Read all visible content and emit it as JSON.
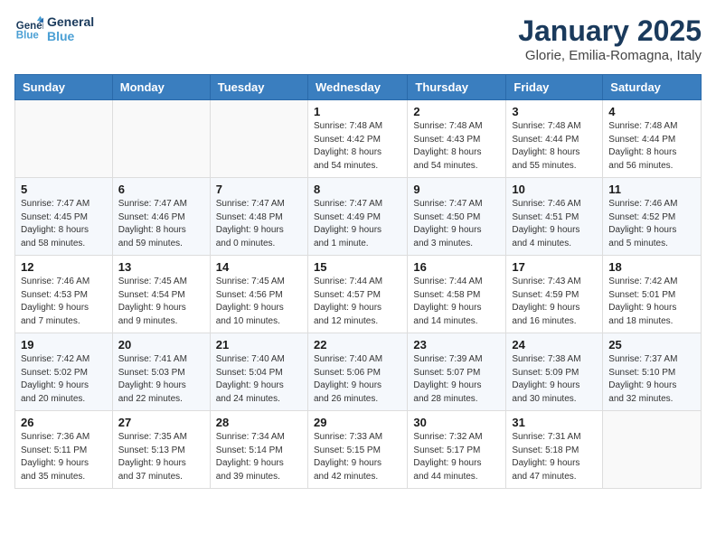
{
  "logo": {
    "line1": "General",
    "line2": "Blue"
  },
  "title": "January 2025",
  "subtitle": "Glorie, Emilia-Romagna, Italy",
  "days_header": [
    "Sunday",
    "Monday",
    "Tuesday",
    "Wednesday",
    "Thursday",
    "Friday",
    "Saturday"
  ],
  "weeks": [
    [
      {
        "num": "",
        "info": ""
      },
      {
        "num": "",
        "info": ""
      },
      {
        "num": "",
        "info": ""
      },
      {
        "num": "1",
        "info": "Sunrise: 7:48 AM\nSunset: 4:42 PM\nDaylight: 8 hours\nand 54 minutes."
      },
      {
        "num": "2",
        "info": "Sunrise: 7:48 AM\nSunset: 4:43 PM\nDaylight: 8 hours\nand 54 minutes."
      },
      {
        "num": "3",
        "info": "Sunrise: 7:48 AM\nSunset: 4:44 PM\nDaylight: 8 hours\nand 55 minutes."
      },
      {
        "num": "4",
        "info": "Sunrise: 7:48 AM\nSunset: 4:44 PM\nDaylight: 8 hours\nand 56 minutes."
      }
    ],
    [
      {
        "num": "5",
        "info": "Sunrise: 7:47 AM\nSunset: 4:45 PM\nDaylight: 8 hours\nand 58 minutes."
      },
      {
        "num": "6",
        "info": "Sunrise: 7:47 AM\nSunset: 4:46 PM\nDaylight: 8 hours\nand 59 minutes."
      },
      {
        "num": "7",
        "info": "Sunrise: 7:47 AM\nSunset: 4:48 PM\nDaylight: 9 hours\nand 0 minutes."
      },
      {
        "num": "8",
        "info": "Sunrise: 7:47 AM\nSunset: 4:49 PM\nDaylight: 9 hours\nand 1 minute."
      },
      {
        "num": "9",
        "info": "Sunrise: 7:47 AM\nSunset: 4:50 PM\nDaylight: 9 hours\nand 3 minutes."
      },
      {
        "num": "10",
        "info": "Sunrise: 7:46 AM\nSunset: 4:51 PM\nDaylight: 9 hours\nand 4 minutes."
      },
      {
        "num": "11",
        "info": "Sunrise: 7:46 AM\nSunset: 4:52 PM\nDaylight: 9 hours\nand 5 minutes."
      }
    ],
    [
      {
        "num": "12",
        "info": "Sunrise: 7:46 AM\nSunset: 4:53 PM\nDaylight: 9 hours\nand 7 minutes."
      },
      {
        "num": "13",
        "info": "Sunrise: 7:45 AM\nSunset: 4:54 PM\nDaylight: 9 hours\nand 9 minutes."
      },
      {
        "num": "14",
        "info": "Sunrise: 7:45 AM\nSunset: 4:56 PM\nDaylight: 9 hours\nand 10 minutes."
      },
      {
        "num": "15",
        "info": "Sunrise: 7:44 AM\nSunset: 4:57 PM\nDaylight: 9 hours\nand 12 minutes."
      },
      {
        "num": "16",
        "info": "Sunrise: 7:44 AM\nSunset: 4:58 PM\nDaylight: 9 hours\nand 14 minutes."
      },
      {
        "num": "17",
        "info": "Sunrise: 7:43 AM\nSunset: 4:59 PM\nDaylight: 9 hours\nand 16 minutes."
      },
      {
        "num": "18",
        "info": "Sunrise: 7:42 AM\nSunset: 5:01 PM\nDaylight: 9 hours\nand 18 minutes."
      }
    ],
    [
      {
        "num": "19",
        "info": "Sunrise: 7:42 AM\nSunset: 5:02 PM\nDaylight: 9 hours\nand 20 minutes."
      },
      {
        "num": "20",
        "info": "Sunrise: 7:41 AM\nSunset: 5:03 PM\nDaylight: 9 hours\nand 22 minutes."
      },
      {
        "num": "21",
        "info": "Sunrise: 7:40 AM\nSunset: 5:04 PM\nDaylight: 9 hours\nand 24 minutes."
      },
      {
        "num": "22",
        "info": "Sunrise: 7:40 AM\nSunset: 5:06 PM\nDaylight: 9 hours\nand 26 minutes."
      },
      {
        "num": "23",
        "info": "Sunrise: 7:39 AM\nSunset: 5:07 PM\nDaylight: 9 hours\nand 28 minutes."
      },
      {
        "num": "24",
        "info": "Sunrise: 7:38 AM\nSunset: 5:09 PM\nDaylight: 9 hours\nand 30 minutes."
      },
      {
        "num": "25",
        "info": "Sunrise: 7:37 AM\nSunset: 5:10 PM\nDaylight: 9 hours\nand 32 minutes."
      }
    ],
    [
      {
        "num": "26",
        "info": "Sunrise: 7:36 AM\nSunset: 5:11 PM\nDaylight: 9 hours\nand 35 minutes."
      },
      {
        "num": "27",
        "info": "Sunrise: 7:35 AM\nSunset: 5:13 PM\nDaylight: 9 hours\nand 37 minutes."
      },
      {
        "num": "28",
        "info": "Sunrise: 7:34 AM\nSunset: 5:14 PM\nDaylight: 9 hours\nand 39 minutes."
      },
      {
        "num": "29",
        "info": "Sunrise: 7:33 AM\nSunset: 5:15 PM\nDaylight: 9 hours\nand 42 minutes."
      },
      {
        "num": "30",
        "info": "Sunrise: 7:32 AM\nSunset: 5:17 PM\nDaylight: 9 hours\nand 44 minutes."
      },
      {
        "num": "31",
        "info": "Sunrise: 7:31 AM\nSunset: 5:18 PM\nDaylight: 9 hours\nand 47 minutes."
      },
      {
        "num": "",
        "info": ""
      }
    ]
  ]
}
